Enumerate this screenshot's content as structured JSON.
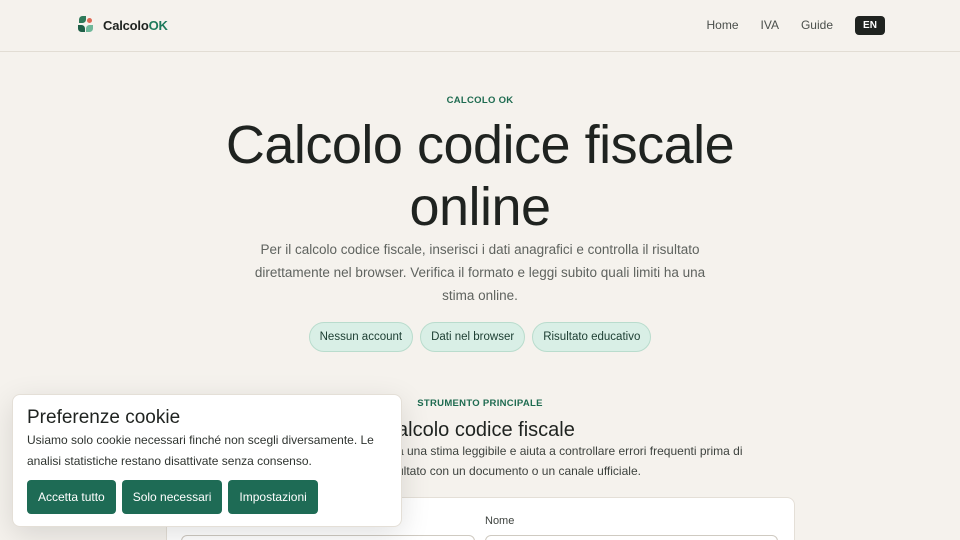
{
  "header": {
    "brand_prefix": "Calcolo",
    "brand_suffix": "OK",
    "nav": [
      "Home",
      "IVA",
      "Guide"
    ],
    "lang": "EN"
  },
  "hero": {
    "eyebrow": "CALCOLO OK",
    "title": "Calcolo codice fiscale online",
    "subtitle": "Per il calcolo codice fiscale, inserisci i dati anagrafici e controlla il risultato direttamente nel browser. Verifica il formato e leggi subito quali limiti ha una stima online.",
    "pills": [
      "Nessun account",
      "Dati nel browser",
      "Risultato educativo"
    ]
  },
  "tool": {
    "eyebrow": "STRUMENTO PRINCIPALE",
    "title_visible": "alcolo codice fiscale",
    "desc_line1": "a una stima leggibile e aiuta a controllare errori frequenti prima di",
    "desc_line2": "ultato con un documento o un canale ufficiale.",
    "field_label": "Nome"
  },
  "cookie": {
    "title": "Preferenze cookie",
    "text": "Usiamo solo cookie necessari finché non scegli diversamente. Le analisi statistiche restano disattivate senza consenso.",
    "buttons": [
      "Accetta tutto",
      "Solo necessari",
      "Impostazioni"
    ]
  },
  "colors": {
    "accent": "#1e6b55",
    "background": "#f5f2ed",
    "pill_bg": "#d9efe6"
  }
}
